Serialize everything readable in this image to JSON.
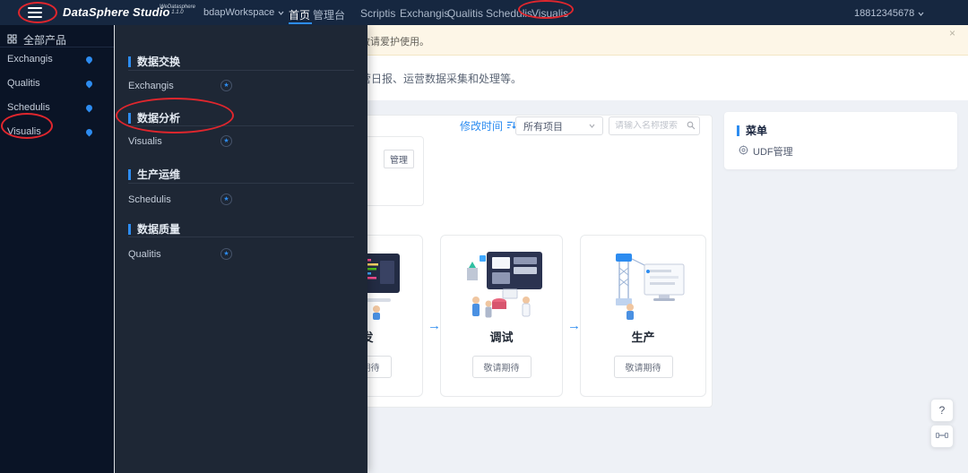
{
  "header": {
    "logo_text": "DataSphere Studio",
    "logo_super": "WeDatasphere",
    "logo_version": "1.1.0",
    "workspace": "bdapWorkspace",
    "nav": [
      "首页",
      "管理台",
      "Scriptis",
      "Exchangis",
      "Qualitis",
      "Schedulis",
      "Visualis"
    ],
    "user": "18812345678"
  },
  "sidebar": {
    "title": "全部产品",
    "items": [
      "Exchangis",
      "Qualitis",
      "Schedulis",
      "Visualis"
    ]
  },
  "flyout": {
    "sections": [
      {
        "title": "数据交换",
        "item": "Exchangis"
      },
      {
        "title": "数据分析",
        "item": "Visualis"
      },
      {
        "title": "生产运维",
        "item": "Schedulis"
      },
      {
        "title": "数据质量",
        "item": "Qualitis"
      }
    ],
    "star_icon": "★"
  },
  "notice": {
    "text": "敬请爱护使用。",
    "close": "×"
  },
  "intro": {
    "text": "营日报、运营数据采集和处理等。"
  },
  "toolbar": {
    "sort_label": "修改时间",
    "project_filter": "所有项目",
    "search_placeholder": "请输入名称搜索"
  },
  "project": {
    "manage_label": "管理"
  },
  "workflow": {
    "arrow": "→",
    "cards": [
      {
        "label": "开发",
        "action": "敬请期待"
      },
      {
        "label": "调试",
        "action": "敬请期待"
      },
      {
        "label": "生产",
        "action": "敬请期待"
      }
    ]
  },
  "menu_panel": {
    "title": "菜单",
    "item": "UDF管理"
  },
  "floating": {
    "help": "?"
  },
  "colors": {
    "accent": "#2d8cf0",
    "annotation": "#e0262d",
    "notice_bg": "#fdf6e7"
  }
}
